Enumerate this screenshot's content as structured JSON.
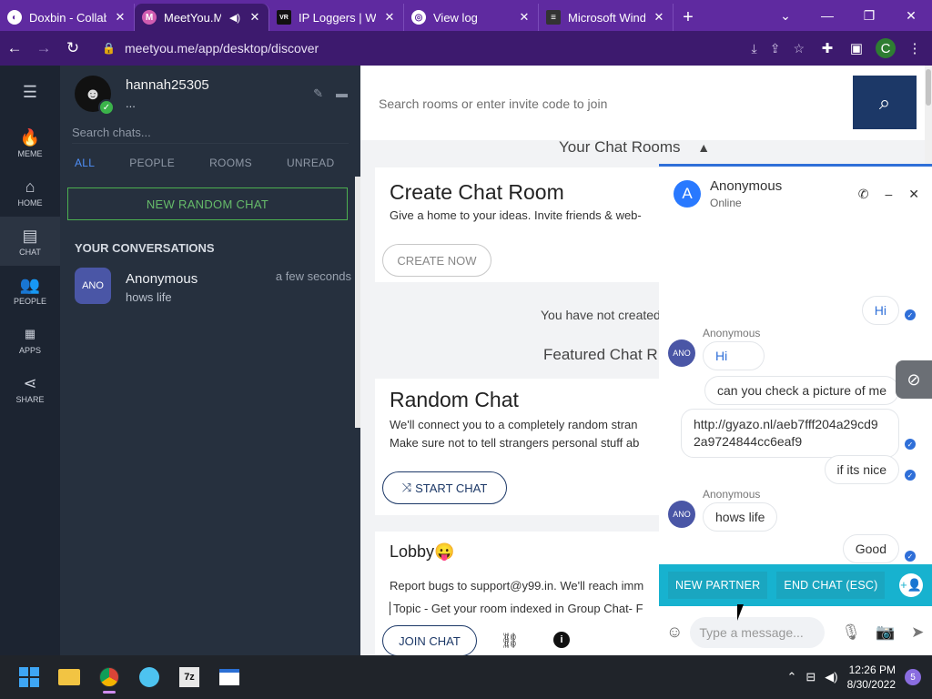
{
  "browser": {
    "tabs": [
      {
        "title": "Doxbin - Collab",
        "fav": "D",
        "fav_color": "#ffffff",
        "fav_text": "#5f2aa0"
      },
      {
        "title": "MeetYou.Me",
        "fav": "M",
        "fav_color": "#d05cb0",
        "fav_text": "#ffffff",
        "active": true
      },
      {
        "title": "IP Loggers | Wel",
        "fav": "VR",
        "fav_color": "#111111",
        "fav_text": "#ffffff"
      },
      {
        "title": "View log",
        "fav": "L",
        "fav_color": "#ffffff",
        "fav_text": "#5f2aa0"
      },
      {
        "title": "Microsoft Windo",
        "fav": "≡",
        "fav_color": "#333333",
        "fav_text": "#ffffff"
      }
    ],
    "url": "meetyou.me/app/desktop/discover",
    "profile_initial": "C"
  },
  "nav": [
    {
      "icon": "🔥",
      "label": "MEME",
      "name": "nav-meme"
    },
    {
      "icon": "⌂",
      "label": "HOME",
      "name": "nav-home"
    },
    {
      "icon": "▤",
      "label": "CHAT",
      "name": "nav-chat",
      "active": true
    },
    {
      "icon": "👥",
      "label": "PEOPLE",
      "name": "nav-people"
    },
    {
      "icon": "⋮⋮⋮",
      "label": "APPS",
      "name": "nav-apps"
    },
    {
      "icon": "⋈",
      "label": "SHARE",
      "name": "nav-share"
    }
  ],
  "sidebar": {
    "username": "hannah25305",
    "status": "...",
    "search_placeholder": "Search chats...",
    "filters": [
      "ALL",
      "PEOPLE",
      "ROOMS",
      "UNREAD"
    ],
    "new_random_chat": "NEW RANDOM CHAT",
    "conversations_header": "YOUR CONVERSATIONS",
    "conversations": [
      {
        "avatar": "ANO",
        "name": "Anonymous",
        "preview": "hows life",
        "time": "a few seconds"
      }
    ]
  },
  "main": {
    "search_placeholder": "Search rooms or enter invite code to join",
    "your_rooms_title": "Your Chat Rooms",
    "create_title": "Create Chat Room",
    "create_desc": "Give a home to your ideas. Invite friends & web-",
    "create_button": "CREATE NOW",
    "not_created": "You have not created",
    "featured_title": "Featured Chat R",
    "random_title": "Random Chat",
    "random_desc1": "We'll connect you to a completely random stran",
    "random_desc2": "Make sure not to tell strangers personal stuff ab",
    "start_chat": "START CHAT",
    "lobby_title": "Lobby😛",
    "lobby_desc1": "Report bugs to support@y99.in. We'll reach imm",
    "lobby_desc2": "Topic - Get your room indexed in Group Chat- F",
    "join_chat": "JOIN CHAT"
  },
  "chat_window": {
    "avatar": "A",
    "name": "Anonymous",
    "status": "Online",
    "messages": [
      {
        "dir": "out",
        "text": "Hi"
      },
      {
        "dir": "in",
        "sender": "Anonymous",
        "avatar": "ANO",
        "text": "Hi"
      },
      {
        "dir": "out",
        "text": "can you check a picture of me"
      },
      {
        "dir": "out",
        "text": "http://gyazo.nl/aeb7fff204a29cd92a9724844cc6eaf9",
        "line1": "http://gyazo.nl/aeb7fff204a29cd9",
        "line2": "2a9724844cc6eaf9"
      },
      {
        "dir": "out",
        "text": "if its nice"
      },
      {
        "dir": "in",
        "sender": "Anonymous",
        "avatar": "ANO",
        "text": "hows life"
      },
      {
        "dir": "out",
        "text": "Good"
      }
    ],
    "new_partner": "NEW PARTNER",
    "end_chat": "END CHAT (ESC)",
    "input_placeholder": "Type a message..."
  },
  "taskbar": {
    "time": "12:26 PM",
    "date": "8/30/2022",
    "notifications": "5"
  }
}
